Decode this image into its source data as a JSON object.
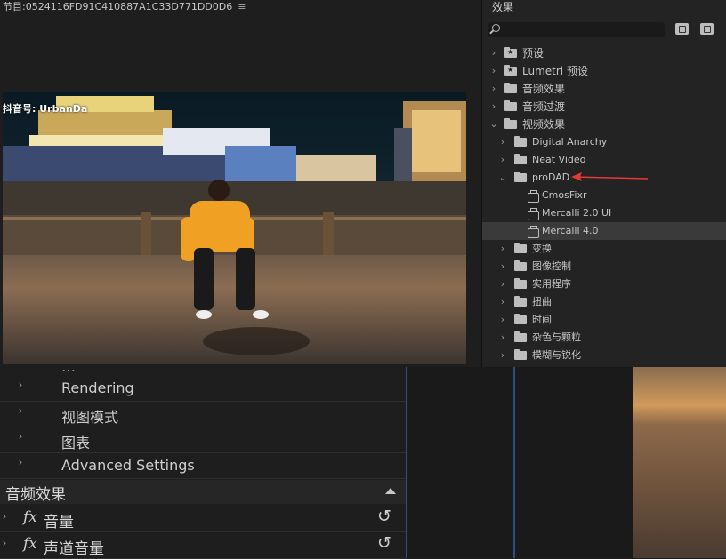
{
  "program": {
    "header": "节目:0524116FD91C410887A1C33D771DD0D6",
    "menu_icon": "hamburger-icon",
    "watermark": "抖音号: UrbanDa"
  },
  "effects": {
    "title": "效果",
    "search": {
      "value": "",
      "placeholder": ""
    },
    "new_bin_buttons": [
      "new-custom-bin-icon",
      "new-preset-bin-icon"
    ],
    "tree": [
      {
        "label": "预设",
        "level": 0,
        "icon": "starred-folder-icon"
      },
      {
        "label": "Lumetri 预设",
        "level": 0,
        "icon": "starred-folder-icon"
      },
      {
        "label": "音频效果",
        "level": 0,
        "icon": "folder-icon"
      },
      {
        "label": "音频过渡",
        "level": 0,
        "icon": "folder-icon"
      },
      {
        "label": "视频效果",
        "level": 0,
        "icon": "folder-icon",
        "expanded": true
      },
      {
        "label": "Digital Anarchy",
        "level": 1,
        "icon": "folder-icon"
      },
      {
        "label": "Neat Video",
        "level": 1,
        "icon": "folder-icon"
      },
      {
        "label": "proDAD",
        "level": 1,
        "icon": "folder-icon",
        "expanded": true
      },
      {
        "label": "CmosFixr",
        "level": 2,
        "icon": "effect-icon"
      },
      {
        "label": "Mercalli 2.0 UI",
        "level": 2,
        "icon": "effect-icon"
      },
      {
        "label": "Mercalli 4.0",
        "level": 2,
        "icon": "effect-icon",
        "selected": true
      },
      {
        "label": "变换",
        "level": 1,
        "icon": "folder-icon"
      },
      {
        "label": "图像控制",
        "level": 1,
        "icon": "folder-icon"
      },
      {
        "label": "实用程序",
        "level": 1,
        "icon": "folder-icon"
      },
      {
        "label": "扭曲",
        "level": 1,
        "icon": "folder-icon"
      },
      {
        "label": "时间",
        "level": 1,
        "icon": "folder-icon"
      },
      {
        "label": "杂色与颗粒",
        "level": 1,
        "icon": "folder-icon"
      },
      {
        "label": "模糊与锐化",
        "level": 1,
        "icon": "folder-icon"
      }
    ],
    "annotation_color": "#e53935"
  },
  "controls": {
    "rows": [
      {
        "label": "Rendering"
      },
      {
        "label": "视图模式"
      },
      {
        "label": "图表"
      },
      {
        "label": "Advanced Settings"
      }
    ],
    "audio_header": "音频效果",
    "fx_symbol": "fx",
    "audio_rows": [
      {
        "label": "音量"
      },
      {
        "label": "声道音量"
      }
    ],
    "reset_icon": "reset-icon"
  },
  "colors": {
    "panel_bg": "#1e1e1e",
    "selected_row": "#3a3a3a",
    "timeline_line": "#2d4f86"
  }
}
